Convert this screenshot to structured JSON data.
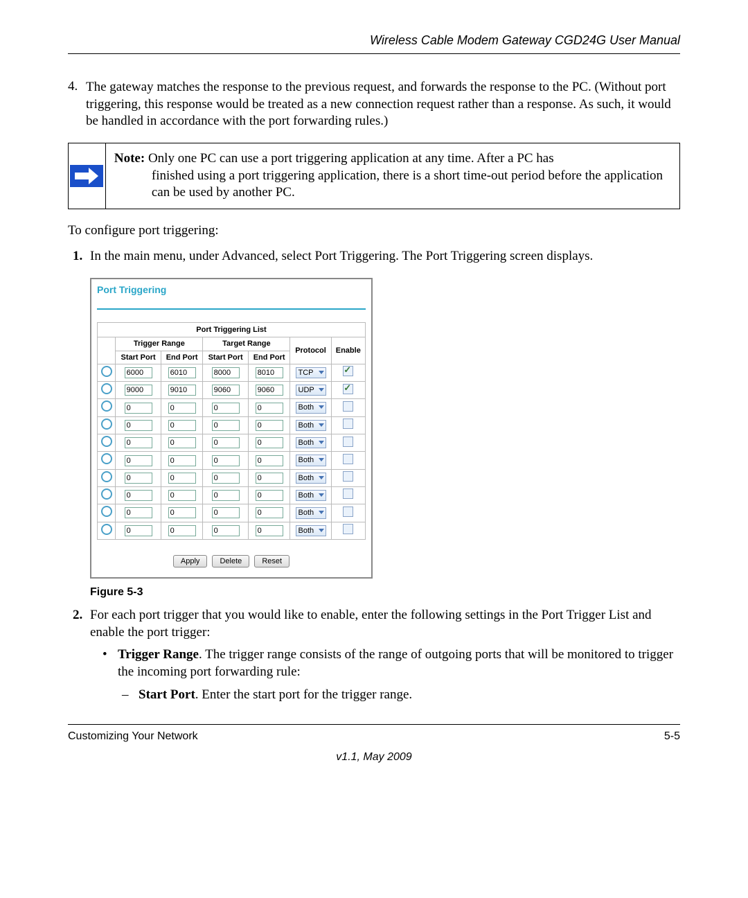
{
  "header": {
    "title": "Wireless Cable Modem Gateway CGD24G User Manual"
  },
  "list4": {
    "num": "4.",
    "text": "The gateway matches the response to the previous request, and forwards the response to the PC. (Without port triggering, this response would be treated as a new connection request rather than a response. As such, it would be handled in accordance with the port forwarding rules.)"
  },
  "note": {
    "label": "Note:",
    "line1": " Only one PC can use a port triggering application at any time. After a PC has",
    "line2": "finished using a port triggering application, there is a short time-out period before the application can be used by another PC."
  },
  "intro": "To configure port triggering:",
  "step1": "In the main menu, under Advanced, select Port Triggering. The Port Triggering screen displays.",
  "screenshot": {
    "title": "Port Triggering",
    "list_caption": "Port Triggering List",
    "headers": {
      "trigger": "Trigger Range",
      "target": "Target Range",
      "startport": "Start Port",
      "endport": "End Port",
      "protocol": "Protocol",
      "enable": "Enable"
    },
    "rows": [
      {
        "ts": "6000",
        "te": "6010",
        "gs": "8000",
        "ge": "8010",
        "proto": "TCP",
        "en": true
      },
      {
        "ts": "9000",
        "te": "9010",
        "gs": "9060",
        "ge": "9060",
        "proto": "UDP",
        "en": true
      },
      {
        "ts": "0",
        "te": "0",
        "gs": "0",
        "ge": "0",
        "proto": "Both",
        "en": false
      },
      {
        "ts": "0",
        "te": "0",
        "gs": "0",
        "ge": "0",
        "proto": "Both",
        "en": false
      },
      {
        "ts": "0",
        "te": "0",
        "gs": "0",
        "ge": "0",
        "proto": "Both",
        "en": false
      },
      {
        "ts": "0",
        "te": "0",
        "gs": "0",
        "ge": "0",
        "proto": "Both",
        "en": false
      },
      {
        "ts": "0",
        "te": "0",
        "gs": "0",
        "ge": "0",
        "proto": "Both",
        "en": false
      },
      {
        "ts": "0",
        "te": "0",
        "gs": "0",
        "ge": "0",
        "proto": "Both",
        "en": false
      },
      {
        "ts": "0",
        "te": "0",
        "gs": "0",
        "ge": "0",
        "proto": "Both",
        "en": false
      },
      {
        "ts": "0",
        "te": "0",
        "gs": "0",
        "ge": "0",
        "proto": "Both",
        "en": false
      }
    ],
    "buttons": {
      "apply": "Apply",
      "delete": "Delete",
      "reset": "Reset"
    }
  },
  "figcap": "Figure 5-3",
  "step2": "For each port trigger that you would like to enable, enter the following settings in the Port Trigger List and enable the port trigger:",
  "bullet_trigger_label": "Trigger Range",
  "bullet_trigger_text": ". The trigger range consists of the range of outgoing ports that will be monitored to trigger the incoming port forwarding rule:",
  "dash_start_label": "Start Port",
  "dash_start_text": ". Enter the start port for the trigger range.",
  "footer": {
    "left": "Customizing Your Network",
    "right": "5-5",
    "version": "v1.1, May 2009"
  }
}
